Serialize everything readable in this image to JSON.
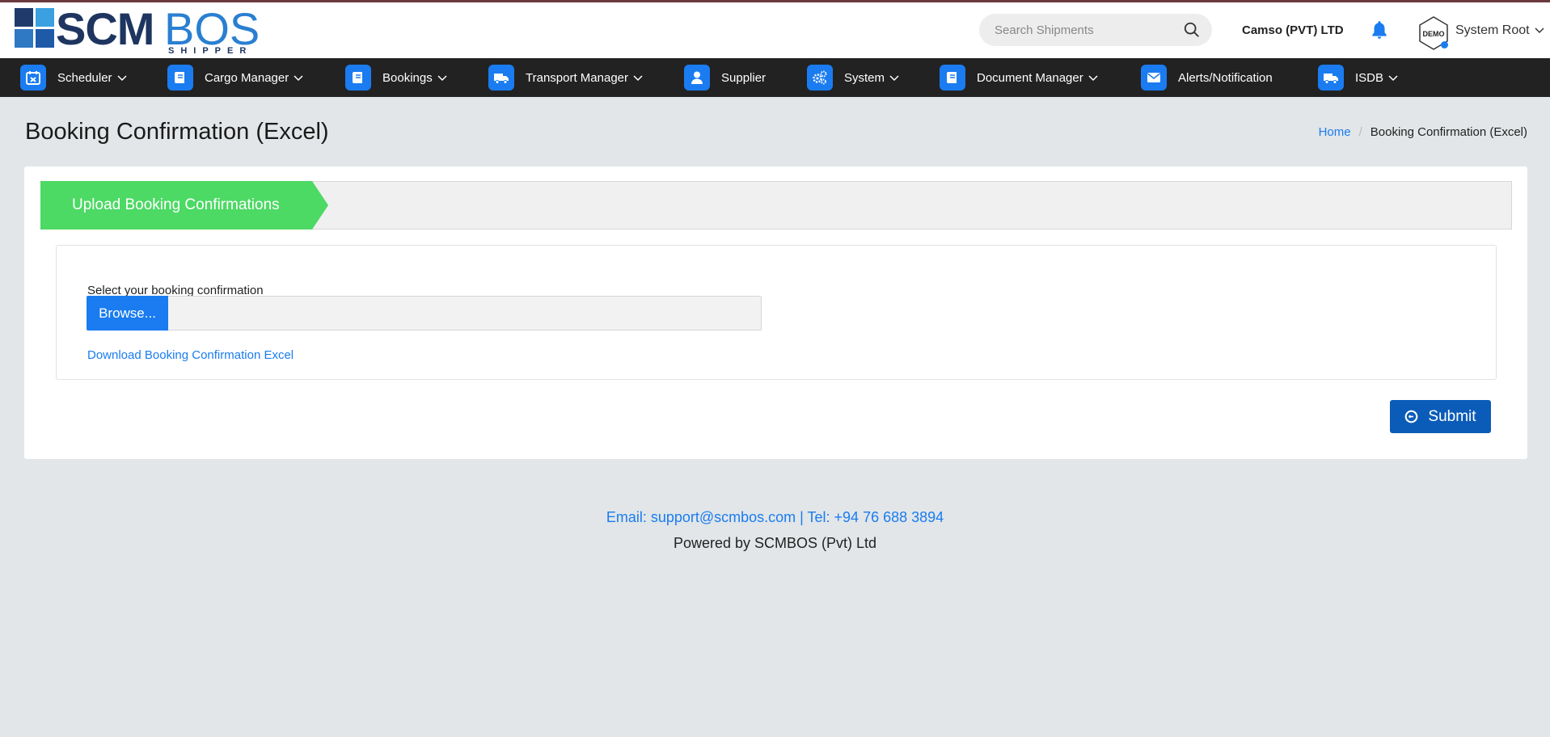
{
  "brand": {
    "primary": "SCM",
    "secondary": "BOS",
    "tagline": "SHIPPER"
  },
  "header": {
    "search_placeholder": "Search Shipments",
    "company": "Camso (PVT) LTD",
    "avatar_text": "DEMO",
    "user_name": "System Root"
  },
  "nav": {
    "items": [
      {
        "label": "Scheduler",
        "icon": "calendar-icon",
        "has_dropdown": true
      },
      {
        "label": "Cargo Manager",
        "icon": "book-icon",
        "has_dropdown": true
      },
      {
        "label": "Bookings",
        "icon": "book-icon",
        "has_dropdown": true
      },
      {
        "label": "Transport Manager",
        "icon": "truck-icon",
        "has_dropdown": true
      },
      {
        "label": "Supplier",
        "icon": "user-icon",
        "has_dropdown": false
      },
      {
        "label": "System",
        "icon": "gears-icon",
        "has_dropdown": true
      },
      {
        "label": "Document Manager",
        "icon": "book-icon",
        "has_dropdown": true
      },
      {
        "label": "Alerts/Notification",
        "icon": "envelope-icon",
        "has_dropdown": false
      },
      {
        "label": "ISDB",
        "icon": "truck-icon",
        "has_dropdown": true
      }
    ]
  },
  "page": {
    "title": "Booking Confirmation (Excel)",
    "breadcrumb": {
      "home": "Home",
      "current": "Booking Confirmation (Excel)"
    }
  },
  "wizard": {
    "step_label": "Upload Booking Confirmations"
  },
  "form": {
    "field_label": "Select your booking confirmation",
    "browse_label": "Browse...",
    "file_value": "",
    "download_link": "Download Booking Confirmation Excel",
    "submit_label": "Submit"
  },
  "footer": {
    "contact": "Email: support@scmbos.com | Tel: +94 76 688 3894",
    "powered": "Powered by SCMBOS (Pvt) Ltd"
  },
  "colors": {
    "accent": "#1a7cf0",
    "nav_bg": "#222222",
    "step_green": "#4cd964",
    "submit_blue": "#0b5cb8",
    "page_bg": "#e2e6e8"
  }
}
